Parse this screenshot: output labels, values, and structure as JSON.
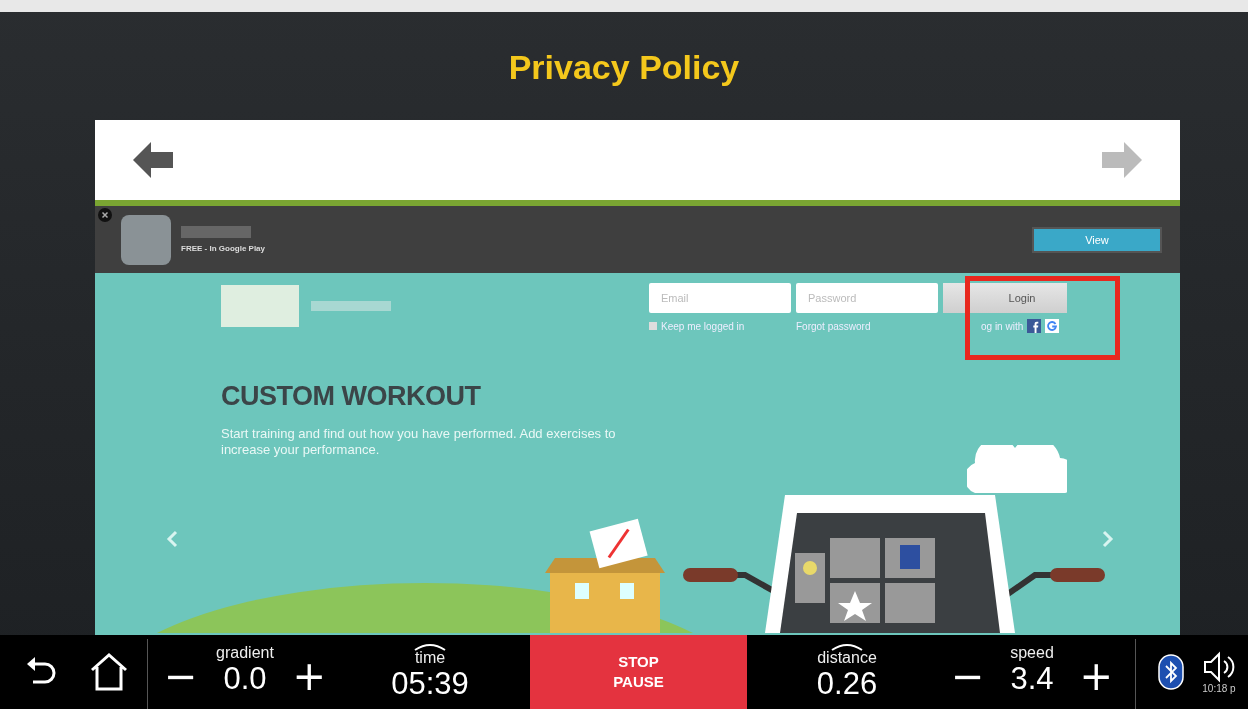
{
  "title": "Privacy Policy",
  "ad": {
    "caption": "FREE - In Google Play",
    "button": "View"
  },
  "login": {
    "email_placeholder": "Email",
    "password_placeholder": "Password",
    "button": "Login",
    "keep_logged_in": {
      "label": "Keep me logged in",
      "checked": false
    },
    "forgot_link": "Forgot password",
    "login_with": "og in with"
  },
  "hero": {
    "heading": "CUSTOM WORKOUT",
    "text": "Start training and find out how you have performed. Add exercises to increase your performance."
  },
  "controls": [
    {
      "kind": "adjust",
      "label": "gradient",
      "value": "0.0",
      "minus": "−",
      "plus": "+"
    },
    {
      "kind": "display",
      "label": "time",
      "value": "05:39"
    },
    {
      "kind": "action",
      "lines": [
        "STOP",
        "PAUSE"
      ]
    },
    {
      "kind": "display",
      "label": "distance",
      "value": "0.26"
    },
    {
      "kind": "adjust",
      "label": "speed",
      "value": "3.4",
      "minus": "−",
      "plus": "+"
    }
  ],
  "clock": "10:18 p"
}
